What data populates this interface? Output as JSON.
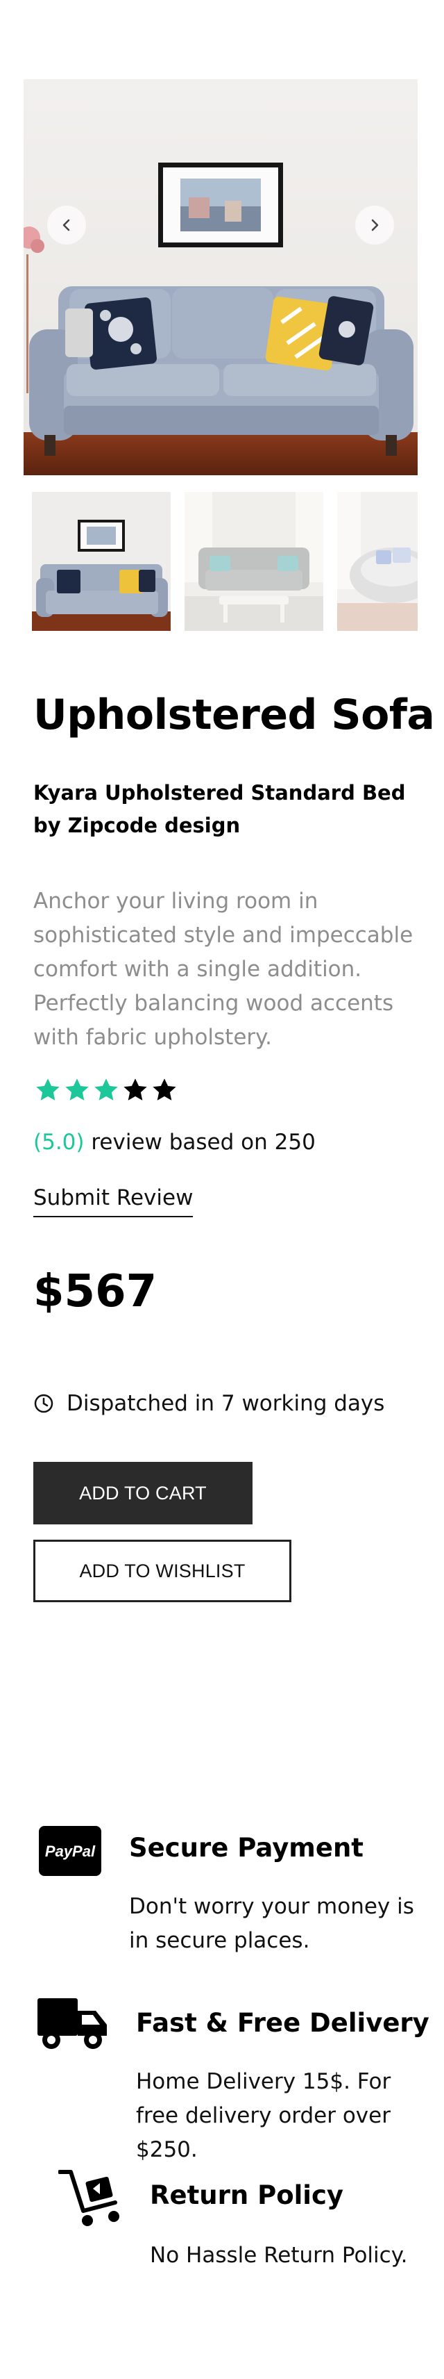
{
  "gallery": {
    "prev_icon": "chevron-left-icon",
    "next_icon": "chevron-right-icon",
    "thumbnails": [
      "sofa-thumbnail",
      "tufted-sofa-thumbnail",
      "round-chair-thumbnail"
    ]
  },
  "product": {
    "title": "Upholstered Sofa",
    "subtitle": "Kyara Upholstered Standard Bed by Zipcode design",
    "description": "Anchor your living room in sophisticated style and impeccable comfort with a single addition. Perfectly balancing wood accents with fabric upholstery.",
    "rating": 3,
    "rating_max": 5,
    "review_score": "(5.0)",
    "review_text": " review based on 250",
    "submit_review": "Submit Review",
    "price": "$567",
    "dispatch_icon": "clock-icon",
    "dispatch": "Dispatched in 7 working days"
  },
  "actions": {
    "add_to_cart": "ADD TO CART",
    "add_to_wishlist": "ADD TO WISHLIST"
  },
  "features": [
    {
      "icon": "paypal-icon",
      "icon_text": "PayPal",
      "title": "Secure Payment",
      "text": "Don't worry your money is in secure places."
    },
    {
      "icon": "delivery-truck-icon",
      "title": "Fast & Free Delivery",
      "text": "Home Delivery 15$. For free delivery order over $250."
    },
    {
      "icon": "return-cart-icon",
      "title": "Return Policy",
      "text": "No Hassle Return Policy."
    }
  ],
  "colors": {
    "accent": "#1cc79a",
    "muted_text": "#8d8d8d",
    "button_dark": "#2b2b2b",
    "star_empty": "#000000"
  }
}
